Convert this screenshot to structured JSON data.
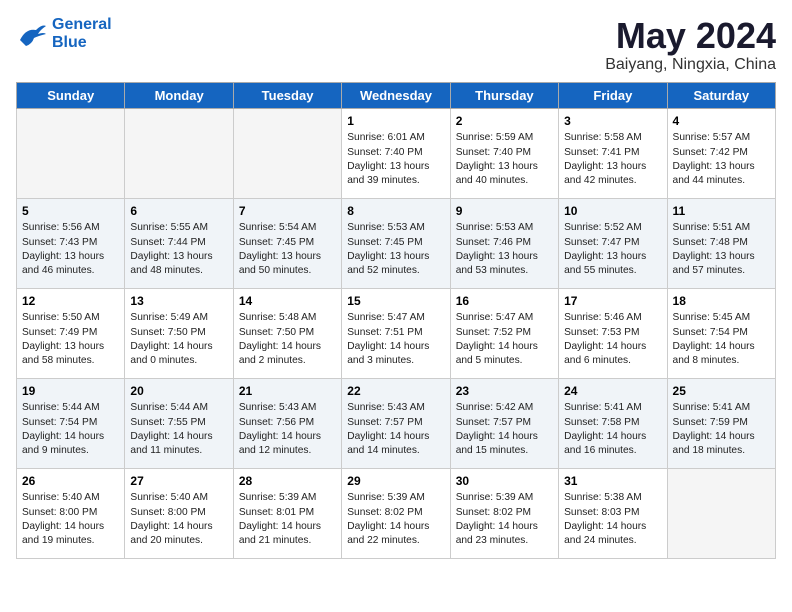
{
  "header": {
    "logo_line1": "General",
    "logo_line2": "Blue",
    "month": "May 2024",
    "location": "Baiyang, Ningxia, China"
  },
  "weekdays": [
    "Sunday",
    "Monday",
    "Tuesday",
    "Wednesday",
    "Thursday",
    "Friday",
    "Saturday"
  ],
  "weeks": [
    [
      {
        "day": "",
        "info": ""
      },
      {
        "day": "",
        "info": ""
      },
      {
        "day": "",
        "info": ""
      },
      {
        "day": "1",
        "info": "Sunrise: 6:01 AM\nSunset: 7:40 PM\nDaylight: 13 hours\nand 39 minutes."
      },
      {
        "day": "2",
        "info": "Sunrise: 5:59 AM\nSunset: 7:40 PM\nDaylight: 13 hours\nand 40 minutes."
      },
      {
        "day": "3",
        "info": "Sunrise: 5:58 AM\nSunset: 7:41 PM\nDaylight: 13 hours\nand 42 minutes."
      },
      {
        "day": "4",
        "info": "Sunrise: 5:57 AM\nSunset: 7:42 PM\nDaylight: 13 hours\nand 44 minutes."
      }
    ],
    [
      {
        "day": "5",
        "info": "Sunrise: 5:56 AM\nSunset: 7:43 PM\nDaylight: 13 hours\nand 46 minutes."
      },
      {
        "day": "6",
        "info": "Sunrise: 5:55 AM\nSunset: 7:44 PM\nDaylight: 13 hours\nand 48 minutes."
      },
      {
        "day": "7",
        "info": "Sunrise: 5:54 AM\nSunset: 7:45 PM\nDaylight: 13 hours\nand 50 minutes."
      },
      {
        "day": "8",
        "info": "Sunrise: 5:53 AM\nSunset: 7:45 PM\nDaylight: 13 hours\nand 52 minutes."
      },
      {
        "day": "9",
        "info": "Sunrise: 5:53 AM\nSunset: 7:46 PM\nDaylight: 13 hours\nand 53 minutes."
      },
      {
        "day": "10",
        "info": "Sunrise: 5:52 AM\nSunset: 7:47 PM\nDaylight: 13 hours\nand 55 minutes."
      },
      {
        "day": "11",
        "info": "Sunrise: 5:51 AM\nSunset: 7:48 PM\nDaylight: 13 hours\nand 57 minutes."
      }
    ],
    [
      {
        "day": "12",
        "info": "Sunrise: 5:50 AM\nSunset: 7:49 PM\nDaylight: 13 hours\nand 58 minutes."
      },
      {
        "day": "13",
        "info": "Sunrise: 5:49 AM\nSunset: 7:50 PM\nDaylight: 14 hours\nand 0 minutes."
      },
      {
        "day": "14",
        "info": "Sunrise: 5:48 AM\nSunset: 7:50 PM\nDaylight: 14 hours\nand 2 minutes."
      },
      {
        "day": "15",
        "info": "Sunrise: 5:47 AM\nSunset: 7:51 PM\nDaylight: 14 hours\nand 3 minutes."
      },
      {
        "day": "16",
        "info": "Sunrise: 5:47 AM\nSunset: 7:52 PM\nDaylight: 14 hours\nand 5 minutes."
      },
      {
        "day": "17",
        "info": "Sunrise: 5:46 AM\nSunset: 7:53 PM\nDaylight: 14 hours\nand 6 minutes."
      },
      {
        "day": "18",
        "info": "Sunrise: 5:45 AM\nSunset: 7:54 PM\nDaylight: 14 hours\nand 8 minutes."
      }
    ],
    [
      {
        "day": "19",
        "info": "Sunrise: 5:44 AM\nSunset: 7:54 PM\nDaylight: 14 hours\nand 9 minutes."
      },
      {
        "day": "20",
        "info": "Sunrise: 5:44 AM\nSunset: 7:55 PM\nDaylight: 14 hours\nand 11 minutes."
      },
      {
        "day": "21",
        "info": "Sunrise: 5:43 AM\nSunset: 7:56 PM\nDaylight: 14 hours\nand 12 minutes."
      },
      {
        "day": "22",
        "info": "Sunrise: 5:43 AM\nSunset: 7:57 PM\nDaylight: 14 hours\nand 14 minutes."
      },
      {
        "day": "23",
        "info": "Sunrise: 5:42 AM\nSunset: 7:57 PM\nDaylight: 14 hours\nand 15 minutes."
      },
      {
        "day": "24",
        "info": "Sunrise: 5:41 AM\nSunset: 7:58 PM\nDaylight: 14 hours\nand 16 minutes."
      },
      {
        "day": "25",
        "info": "Sunrise: 5:41 AM\nSunset: 7:59 PM\nDaylight: 14 hours\nand 18 minutes."
      }
    ],
    [
      {
        "day": "26",
        "info": "Sunrise: 5:40 AM\nSunset: 8:00 PM\nDaylight: 14 hours\nand 19 minutes."
      },
      {
        "day": "27",
        "info": "Sunrise: 5:40 AM\nSunset: 8:00 PM\nDaylight: 14 hours\nand 20 minutes."
      },
      {
        "day": "28",
        "info": "Sunrise: 5:39 AM\nSunset: 8:01 PM\nDaylight: 14 hours\nand 21 minutes."
      },
      {
        "day": "29",
        "info": "Sunrise: 5:39 AM\nSunset: 8:02 PM\nDaylight: 14 hours\nand 22 minutes."
      },
      {
        "day": "30",
        "info": "Sunrise: 5:39 AM\nSunset: 8:02 PM\nDaylight: 14 hours\nand 23 minutes."
      },
      {
        "day": "31",
        "info": "Sunrise: 5:38 AM\nSunset: 8:03 PM\nDaylight: 14 hours\nand 24 minutes."
      },
      {
        "day": "",
        "info": ""
      }
    ]
  ]
}
